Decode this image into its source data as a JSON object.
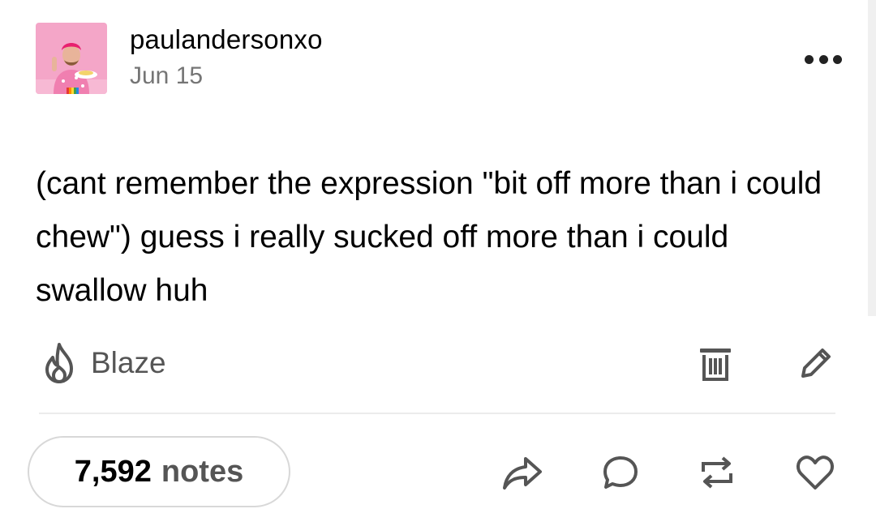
{
  "post": {
    "username": "paulandersonxo",
    "date": "Jun 15",
    "body": "(cant remember the expression \"bit off more than i could chew\") guess i really sucked off more than i could swallow huh"
  },
  "actions": {
    "blaze_label": "Blaze"
  },
  "footer": {
    "notes_count": "7,592",
    "notes_label": "notes"
  },
  "icons": {
    "more": "more-options-icon",
    "blaze": "flame-icon",
    "delete": "trash-icon",
    "edit": "pencil-icon",
    "share": "share-icon",
    "reply": "comment-icon",
    "reblog": "reblog-icon",
    "like": "heart-icon"
  },
  "colors": {
    "avatar_bg": "#f4a6c8",
    "text": "#000000",
    "muted": "#757575",
    "icon": "#555555"
  }
}
